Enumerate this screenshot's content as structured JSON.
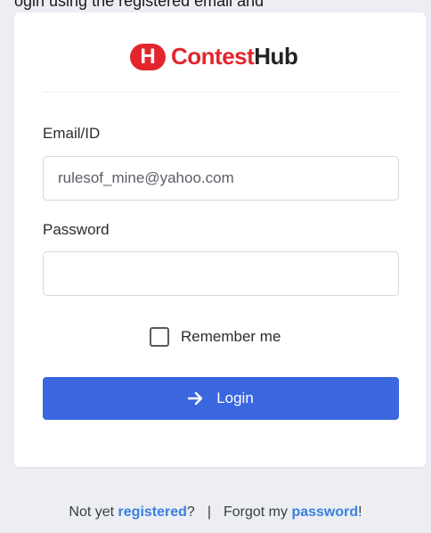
{
  "page": {
    "cut_text": "ogin using the registered email and"
  },
  "brand": {
    "logo_letter": "H",
    "name_part1": "Contest",
    "name_part2": "Hub",
    "accent": "#e3262e"
  },
  "form": {
    "email_label": "Email/ID",
    "email_value": "rulesof_mine@yahoo.com",
    "password_label": "Password",
    "password_value": "",
    "remember_label": "Remember me",
    "remember_checked": false,
    "login_label": "Login",
    "login_icon": "arrow-right-icon",
    "button_color": "#3a66df"
  },
  "footer": {
    "not_yet": "Not yet ",
    "registered": "registered",
    "question": "?",
    "separator": "|",
    "forgot": "Forgot my ",
    "password": "password",
    "exclaim": "!",
    "link_color": "#3a7fe0"
  }
}
